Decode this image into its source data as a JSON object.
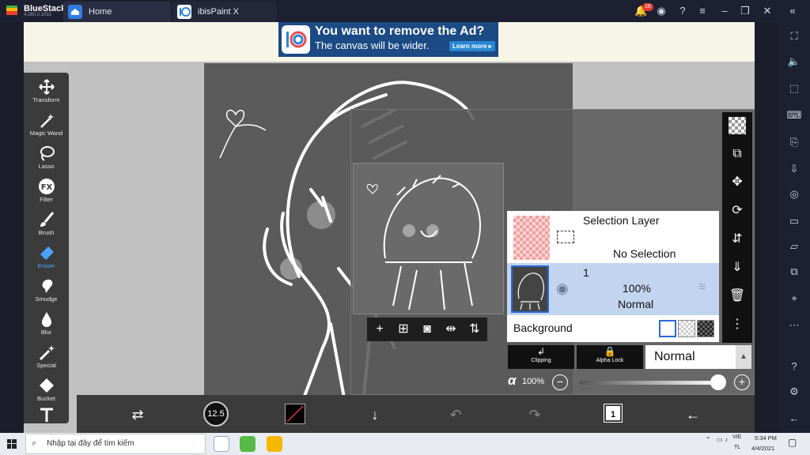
{
  "bluestacks": {
    "name": "BlueStacks",
    "version": "4.260.0.1032",
    "tabs": [
      {
        "label": "Home"
      },
      {
        "label": "ibisPaint X"
      }
    ],
    "notification_count": "16"
  },
  "ad": {
    "title": "You want to remove the Ad?",
    "subtitle": "The canvas will be wider.",
    "button": "Learn more ▸"
  },
  "tools": [
    {
      "label": "Transform",
      "icon": "transform-icon"
    },
    {
      "label": "Magic Wand",
      "icon": "magic-wand-icon"
    },
    {
      "label": "Lasso",
      "icon": "lasso-icon"
    },
    {
      "label": "Filter",
      "icon": "filter-fx-icon"
    },
    {
      "label": "Brush",
      "icon": "brush-icon"
    },
    {
      "label": "Eraser",
      "icon": "eraser-icon"
    },
    {
      "label": "Smudge",
      "icon": "smudge-icon"
    },
    {
      "label": "Blur",
      "icon": "blur-icon"
    },
    {
      "label": "Special",
      "icon": "special-icon"
    },
    {
      "label": "Bucket",
      "icon": "bucket-icon"
    },
    {
      "label": "",
      "icon": "text-icon"
    }
  ],
  "layers": {
    "selection_layer_title": "Selection Layer",
    "selection_layer_status": "No Selection",
    "layer1_name": "1",
    "layer1_opacity": "100%",
    "layer1_blend": "Normal",
    "background_label": "Background"
  },
  "panel": {
    "clipping": "Clipping",
    "alpha_lock": "Alpha Lock",
    "blend_mode": "Normal",
    "alpha_symbol": "α",
    "opacity": "100%"
  },
  "bottom_bar": {
    "brush_size": "12.5",
    "layer_count": "1"
  },
  "taskbar": {
    "search_placeholder": "Nhập tại đây để tìm kiếm",
    "lang_line1": "VIE",
    "lang_line2": "TL",
    "time": "5:34 PM",
    "date": "4/4/2021"
  }
}
